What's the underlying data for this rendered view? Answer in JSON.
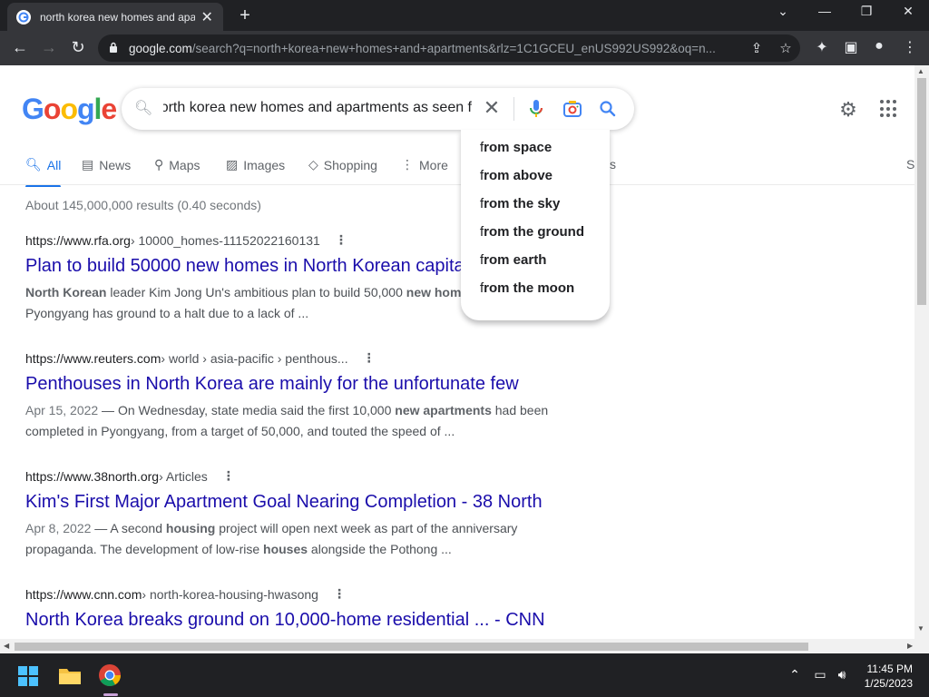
{
  "browser": {
    "tab_title": "north korea new homes and apar",
    "url_host": "google.com",
    "url_path": "/search?q=north+korea+new+homes+and+apartments&rlz=1C1GCEU_enUS992US992&oq=n...",
    "new_tab_label": "+",
    "controls": {
      "minimize": "—",
      "restore": "❐",
      "close": "✕",
      "dropdown": "⌄"
    }
  },
  "google": {
    "logo": {
      "letters": [
        "G",
        "o",
        "o",
        "g",
        "l",
        "e"
      ],
      "colors": [
        "#4285f4",
        "#ea4335",
        "#fbbc05",
        "#4285f4",
        "#34a853",
        "#ea4335"
      ]
    },
    "search_query": "north korea new homes and apartments as seen f",
    "nav_tabs": [
      {
        "label": "All",
        "icon": "search-icon"
      },
      {
        "label": "News",
        "icon": "news-icon"
      },
      {
        "label": "Maps",
        "icon": "pin-icon"
      },
      {
        "label": "Images",
        "icon": "image-icon"
      },
      {
        "label": "Shopping",
        "icon": "tag-icon"
      },
      {
        "label": "More",
        "icon": "kebab-icon"
      }
    ],
    "hidden_tab_tail": "s",
    "hidden_tab_right": "S",
    "result_stats": "About 145,000,000 results (0.40 seconds)"
  },
  "suggestions": {
    "typed_prefix": "f",
    "items": [
      "rom space",
      "rom above",
      "rom the sky",
      "rom the ground",
      "rom earth",
      "rom the moon"
    ]
  },
  "results": [
    {
      "cite_host": "https://www.rfa.org",
      "cite_path": " › 10000_homes-11152022160131",
      "title": "Plan to build 50000 new homes in North Korean capita",
      "snippet_line1_parts": [
        "North Korean",
        " leader Kim Jong Un's ambitious plan to build 50,000 ",
        "new home"
      ],
      "snippet_line2": "Pyongyang has ground to a halt due to a lack of ..."
    },
    {
      "cite_host": "https://www.reuters.com",
      "cite_path": " › world › asia-pacific › penthous...",
      "title": "Penthouses in North Korea are mainly for the unfortunate few",
      "date": "Apr 15, 2022",
      "snippet_line1_parts": [
        " — On Wednesday, state media said the first 10,000 ",
        "new apartments",
        " had been"
      ],
      "snippet_line2": "completed in Pyongyang, from a target of 50,000, and touted the speed of ..."
    },
    {
      "cite_host": "https://www.38north.org",
      "cite_path": " › Articles",
      "title": "Kim's First Major Apartment Goal Nearing Completion - 38 North",
      "date": "Apr 8, 2022",
      "snippet_line1_parts": [
        " — A second ",
        "housing",
        " project will open next week as part of the anniversary"
      ],
      "snippet_line2_parts": [
        "propaganda. The development of low-rise ",
        "houses",
        " alongside the Pothong ..."
      ]
    },
    {
      "cite_host": "https://www.cnn.com",
      "cite_path": " › north-korea-housing-hwasong",
      "title": "North Korea breaks ground on 10,000-home residential ... - CNN"
    }
  ],
  "taskbar": {
    "time": "11:45 PM",
    "date": "1/25/2023"
  }
}
